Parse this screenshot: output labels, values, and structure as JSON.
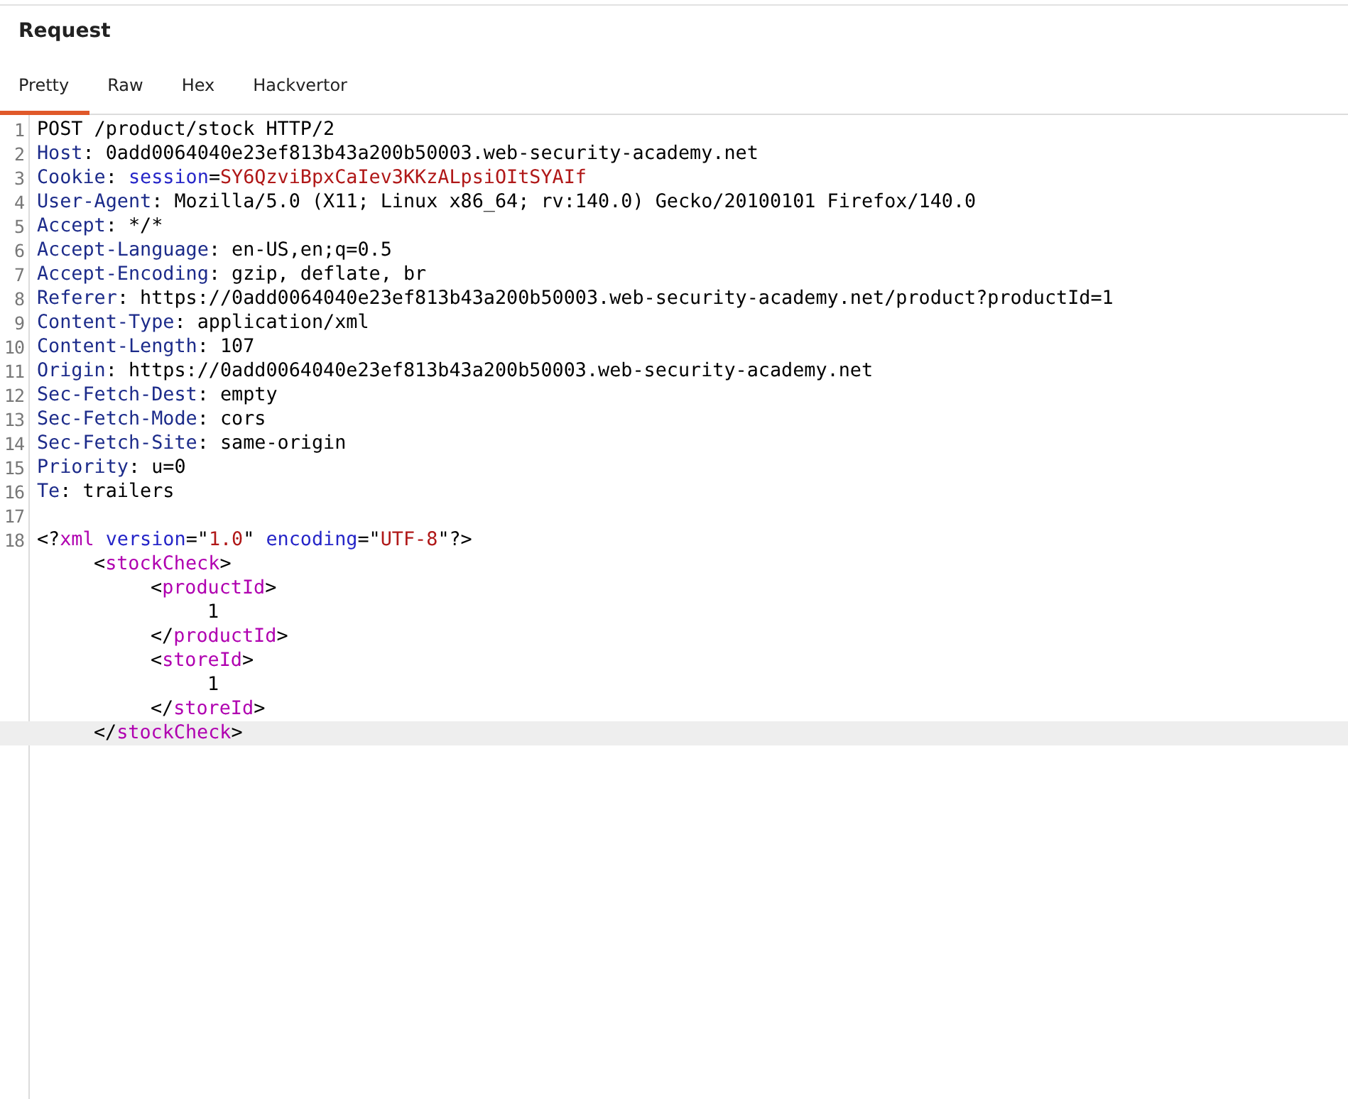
{
  "panel": {
    "title": "Request"
  },
  "tabs": [
    {
      "label": "Pretty",
      "selected": true
    },
    {
      "label": "Raw",
      "selected": false
    },
    {
      "label": "Hex",
      "selected": false
    },
    {
      "label": "Hackvertor",
      "selected": false
    }
  ],
  "editor": {
    "lines": [
      {
        "number": "1",
        "tokens": [
          {
            "kind": "text",
            "text": "POST /product/stock HTTP/2"
          }
        ]
      },
      {
        "number": "2",
        "tokens": [
          {
            "kind": "name",
            "text": "Host"
          },
          {
            "kind": "text",
            "text": ": 0add0064040e23ef813b43a200b50003.web-security-academy.net"
          }
        ]
      },
      {
        "number": "3",
        "tokens": [
          {
            "kind": "name",
            "text": "Cookie"
          },
          {
            "kind": "text",
            "text": ": "
          },
          {
            "kind": "attr",
            "text": "session"
          },
          {
            "kind": "text",
            "text": "="
          },
          {
            "kind": "string",
            "text": "SY6QzviBpxCaIev3KKzALpsiOItSYAIf"
          }
        ]
      },
      {
        "number": "4",
        "tokens": [
          {
            "kind": "name",
            "text": "User-Agent"
          },
          {
            "kind": "text",
            "text": ": Mozilla/5.0 (X11; Linux x86_64; rv:140.0) Gecko/20100101 Firefox/140.0"
          }
        ]
      },
      {
        "number": "5",
        "tokens": [
          {
            "kind": "name",
            "text": "Accept"
          },
          {
            "kind": "text",
            "text": ": */*"
          }
        ]
      },
      {
        "number": "6",
        "tokens": [
          {
            "kind": "name",
            "text": "Accept-Language"
          },
          {
            "kind": "text",
            "text": ": en-US,en;q=0.5"
          }
        ]
      },
      {
        "number": "7",
        "tokens": [
          {
            "kind": "name",
            "text": "Accept-Encoding"
          },
          {
            "kind": "text",
            "text": ": gzip, deflate, br"
          }
        ]
      },
      {
        "number": "8",
        "tokens": [
          {
            "kind": "name",
            "text": "Referer"
          },
          {
            "kind": "text",
            "text": ": https://0add0064040e23ef813b43a200b50003.web-security-academy.net/product?productId=1"
          }
        ]
      },
      {
        "number": "9",
        "tokens": [
          {
            "kind": "name",
            "text": "Content-Type"
          },
          {
            "kind": "text",
            "text": ": application/xml"
          }
        ]
      },
      {
        "number": "10",
        "tokens": [
          {
            "kind": "name",
            "text": "Content-Length"
          },
          {
            "kind": "text",
            "text": ": 107"
          }
        ]
      },
      {
        "number": "11",
        "tokens": [
          {
            "kind": "name",
            "text": "Origin"
          },
          {
            "kind": "text",
            "text": ": https://0add0064040e23ef813b43a200b50003.web-security-academy.net"
          }
        ]
      },
      {
        "number": "12",
        "tokens": [
          {
            "kind": "name",
            "text": "Sec-Fetch-Dest"
          },
          {
            "kind": "text",
            "text": ": empty"
          }
        ]
      },
      {
        "number": "13",
        "tokens": [
          {
            "kind": "name",
            "text": "Sec-Fetch-Mode"
          },
          {
            "kind": "text",
            "text": ": cors"
          }
        ]
      },
      {
        "number": "14",
        "tokens": [
          {
            "kind": "name",
            "text": "Sec-Fetch-Site"
          },
          {
            "kind": "text",
            "text": ": same-origin"
          }
        ]
      },
      {
        "number": "15",
        "tokens": [
          {
            "kind": "name",
            "text": "Priority"
          },
          {
            "kind": "text",
            "text": ": u=0"
          }
        ]
      },
      {
        "number": "16",
        "tokens": [
          {
            "kind": "name",
            "text": "Te"
          },
          {
            "kind": "text",
            "text": ": trailers"
          }
        ]
      },
      {
        "number": "17"
      },
      {
        "number": "18",
        "tokens": [
          {
            "kind": "text",
            "text": "<?"
          },
          {
            "kind": "tag",
            "text": "xml"
          },
          {
            "kind": "attr",
            "text": " version"
          },
          {
            "kind": "text",
            "text": "=\""
          },
          {
            "kind": "string",
            "text": "1.0"
          },
          {
            "kind": "text",
            "text": "\" "
          },
          {
            "kind": "attr",
            "text": "encoding"
          },
          {
            "kind": "text",
            "text": "=\""
          },
          {
            "kind": "string",
            "text": "UTF-8"
          },
          {
            "kind": "text",
            "text": "\"?>"
          }
        ],
        "highlighted": false,
        "children": [
          {
            "tokens": [
              {
                "kind": "text",
                "text": "<"
              },
              {
                "kind": "tag",
                "text": "stockCheck"
              },
              {
                "kind": "text",
                "text": ">"
              }
            ],
            "highlighted": false,
            "children": [
              {
                "tokens": [
                  {
                    "kind": "text",
                    "text": "<"
                  },
                  {
                    "kind": "tag",
                    "text": "productId"
                  },
                  {
                    "kind": "text",
                    "text": ">"
                  }
                ],
                "highlighted": false,
                "children": [
                  {
                    "tokens": [
                      {
                        "kind": "text",
                        "text": "1"
                      }
                    ],
                    "highlighted": false
                  }
                ]
              },
              {
                "tokens": [
                  {
                    "kind": "text",
                    "text": "</"
                  },
                  {
                    "kind": "tag",
                    "text": "productId"
                  },
                  {
                    "kind": "text",
                    "text": ">"
                  }
                ],
                "highlighted": false
              },
              {
                "tokens": [
                  {
                    "kind": "text",
                    "text": "<"
                  },
                  {
                    "kind": "tag",
                    "text": "storeId"
                  },
                  {
                    "kind": "text",
                    "text": ">"
                  }
                ],
                "highlighted": false,
                "children": [
                  {
                    "tokens": [
                      {
                        "kind": "text",
                        "text": "1"
                      }
                    ],
                    "highlighted": false
                  }
                ]
              },
              {
                "tokens": [
                  {
                    "kind": "text",
                    "text": "</"
                  },
                  {
                    "kind": "tag",
                    "text": "storeId"
                  },
                  {
                    "kind": "text",
                    "text": ">"
                  }
                ],
                "highlighted": false
              }
            ]
          },
          {
            "tokens": [
              {
                "kind": "text",
                "text": "</"
              },
              {
                "kind": "tag",
                "text": "stockCheck"
              },
              {
                "kind": "text",
                "text": ">"
              }
            ],
            "highlighted": true
          }
        ]
      }
    ]
  }
}
